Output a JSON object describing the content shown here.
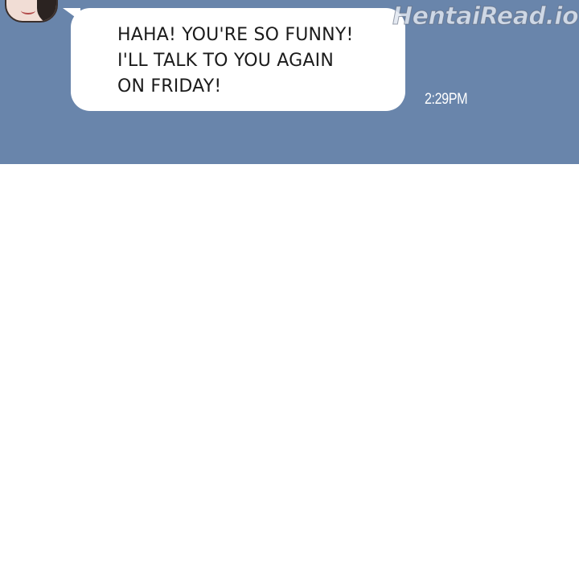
{
  "chat": {
    "message": "HAHA! YOU'RE SO FUNNY!\nI'LL TALK TO YOU AGAIN\nON FRIDAY!",
    "timestamp": "2:29PM"
  },
  "watermark": "HentaiRead.io",
  "colors": {
    "panel_background": "#6985ab",
    "bubble": "#ffffff",
    "page_background": "#ffffff"
  }
}
